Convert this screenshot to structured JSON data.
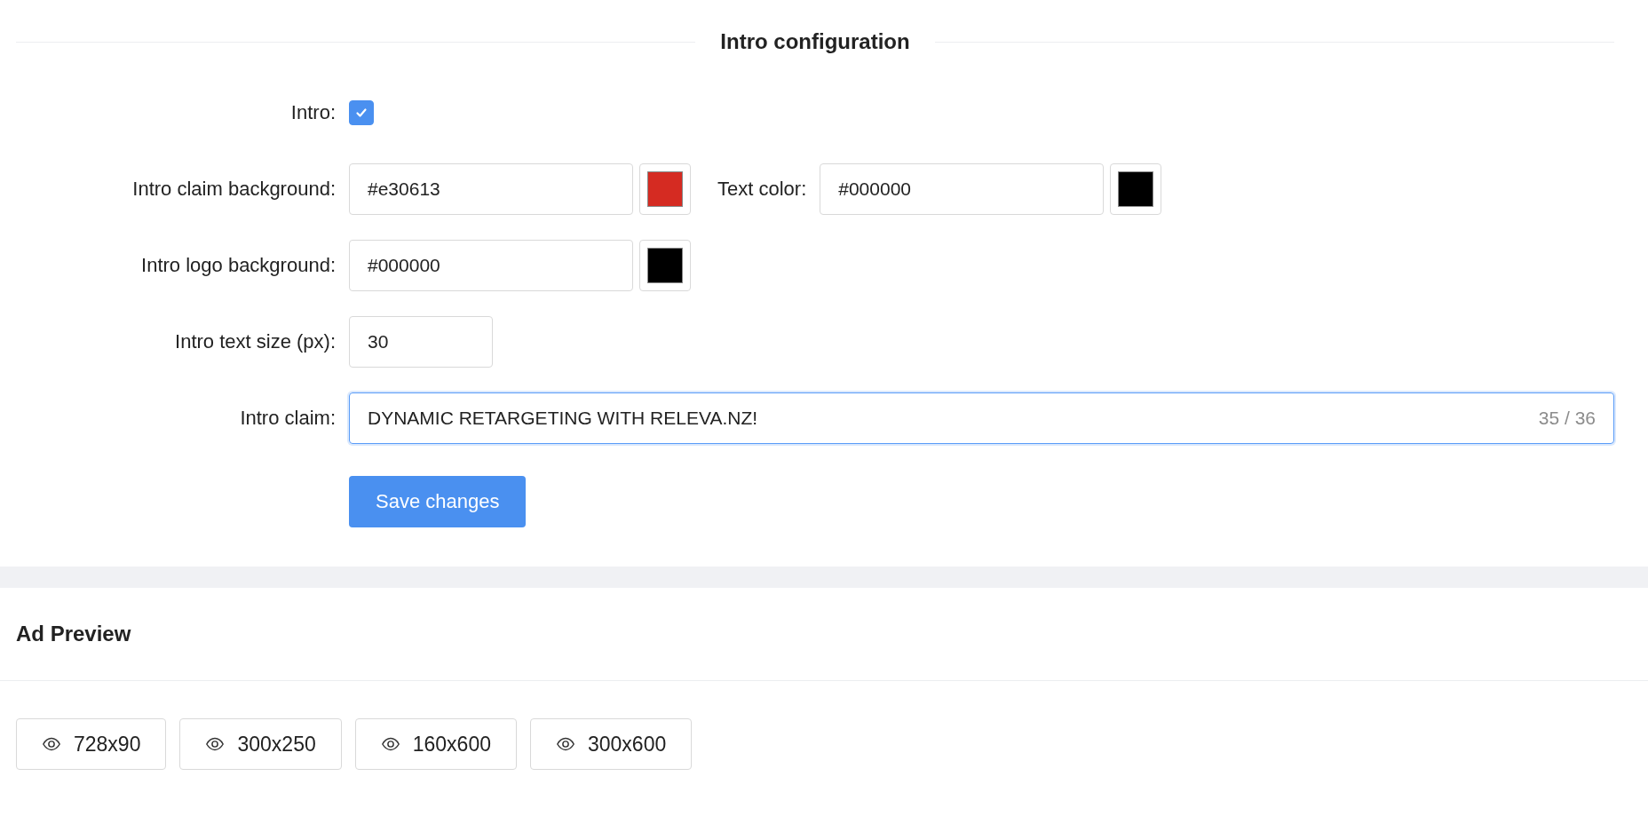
{
  "config": {
    "title": "Intro configuration",
    "rows": [
      {
        "items": [
          {
            "kind": "checkbox",
            "label": "Intro:",
            "checked": true
          }
        ]
      },
      {
        "items": [
          {
            "kind": "color",
            "label": "Intro claim background:",
            "value": "#e30613",
            "color": "#d52b22"
          },
          {
            "kind": "color",
            "label": "Text color:",
            "value": "#000000",
            "color": "#000000"
          }
        ]
      },
      {
        "items": [
          {
            "kind": "color",
            "label": "Intro logo background:",
            "value": "#000000",
            "color": "#000000"
          }
        ]
      },
      {
        "items": [
          {
            "kind": "number",
            "label": "Intro text size (px):",
            "value": "30"
          }
        ]
      },
      {
        "items": [
          {
            "kind": "text",
            "label": "Intro claim:",
            "value": "DYNAMIC RETARGETING WITH RELEVA.NZ!",
            "counter": "35 / 36",
            "focused": true
          }
        ]
      }
    ],
    "save_button": "Save changes"
  },
  "preview": {
    "title": "Ad Preview",
    "buttons": [
      "728x90",
      "300x250",
      "160x600",
      "300x600"
    ]
  }
}
